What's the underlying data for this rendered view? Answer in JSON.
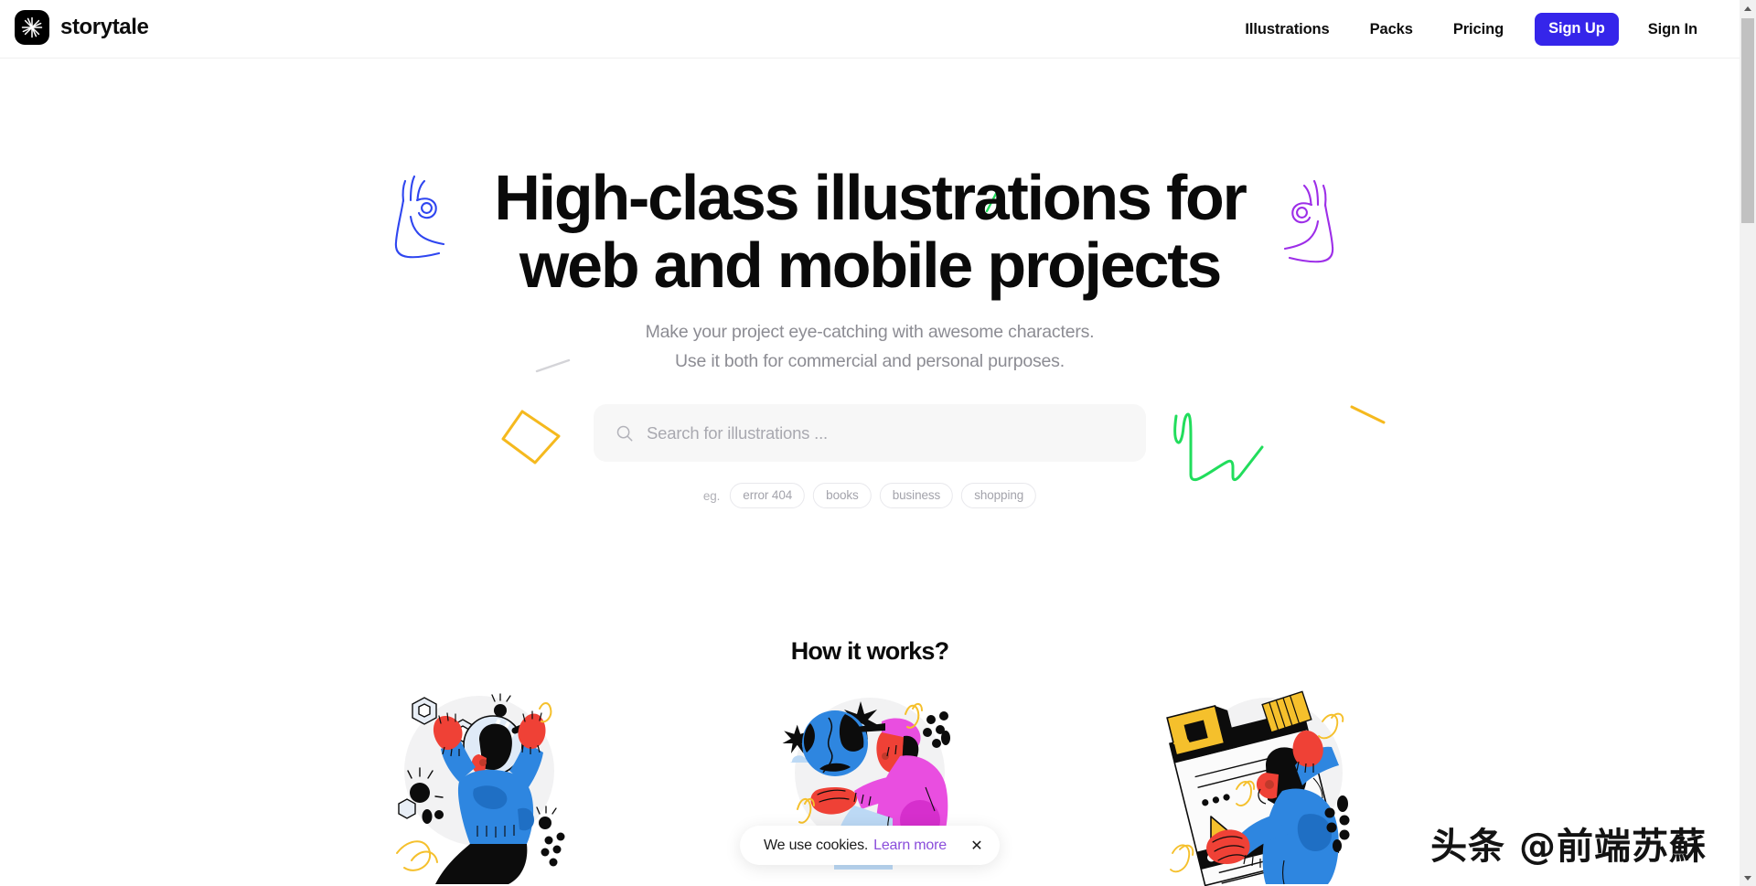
{
  "header": {
    "brand_name": "storytale",
    "logo_icon": "starburst-icon",
    "nav": [
      {
        "label": "Illustrations",
        "name": "nav-link-illustrations"
      },
      {
        "label": "Packs",
        "name": "nav-link-packs"
      },
      {
        "label": "Pricing",
        "name": "nav-link-pricing"
      }
    ],
    "sign_up_label": "Sign Up",
    "sign_in_label": "Sign In",
    "accent_color": "#3525ea"
  },
  "hero": {
    "headline_line1": "High-class illustrations for",
    "headline_line2": "web and mobile projects",
    "subtitle_line1": "Make your project eye-catching with awesome characters.",
    "subtitle_line2": "Use it both for commercial and personal purposes."
  },
  "search": {
    "placeholder": "Search for illustrations ...",
    "value": "",
    "icon": "search-icon"
  },
  "tags": {
    "label": "eg.",
    "items": [
      {
        "label": "error 404"
      },
      {
        "label": "books"
      },
      {
        "label": "business"
      },
      {
        "label": "shopping"
      }
    ]
  },
  "doodles": {
    "hand_left_color": "#2f46f0",
    "hand_right_color": "#9d2ee8",
    "square_color": "#f5b91e",
    "zigzag_color": "#21dd5c",
    "tick_color": "#21dd5c",
    "dash_color": "#f5b91e"
  },
  "how_it_works": {
    "title": "How it works?",
    "cards": [
      {
        "name": "card-illustration-search",
        "alt": "person with magnifying glass"
      },
      {
        "name": "card-illustration-globe",
        "alt": "person holding globe"
      },
      {
        "name": "card-illustration-design",
        "alt": "person designing a web page"
      }
    ]
  },
  "cookie_banner": {
    "text": "We use cookies.",
    "link_label": "Learn more",
    "link_color": "#8a4ddb",
    "close_label": "✕"
  },
  "watermark": {
    "text": "头条 @前端苏蘇"
  },
  "scrollbar": {
    "up_arrow": "scroll-up-arrow-icon",
    "down_arrow": "scroll-down-arrow-icon"
  }
}
